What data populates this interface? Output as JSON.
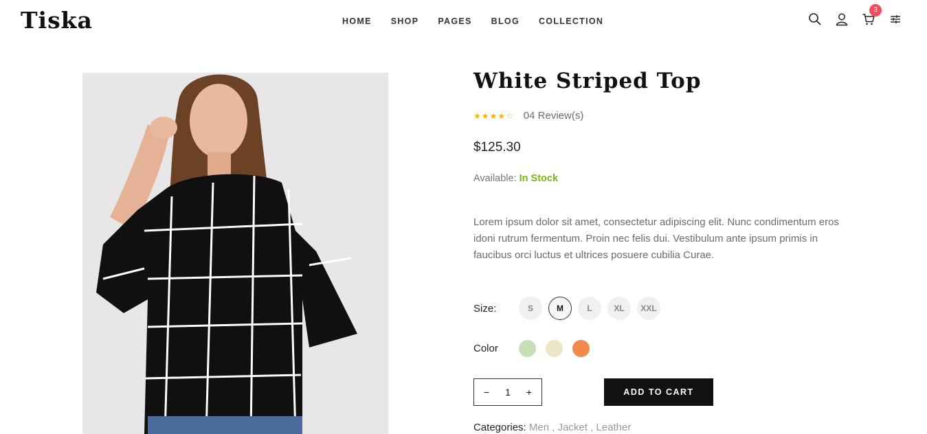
{
  "header": {
    "logo": "Tiska",
    "nav": [
      "HOME",
      "SHOP",
      "PAGES",
      "BLOG",
      "COLLECTION"
    ],
    "cart_count": "3",
    "icons": [
      "search-icon",
      "user-icon",
      "cart-icon",
      "filter-icon"
    ]
  },
  "product": {
    "title": "White Striped Top",
    "stars": "★★★★☆",
    "rating": 4.5,
    "reviews": "04 Review(s)",
    "price": "$125.30",
    "availability_label": "Available:",
    "availability_value": "In Stock",
    "description": "Lorem ipsum dolor sit amet, consectetur adipiscing elit. Nunc condimentum eros idoni rutrum fermentum. Proin nec felis dui. Vestibulum ante ipsum primis in faucibus orci luctus et ultrices posuere cubilia Curae.",
    "size_label": "Size:",
    "sizes": [
      "S",
      "M",
      "L",
      "XL",
      "XXL"
    ],
    "selected_size": "M",
    "color_label": "Color",
    "colors": [
      "#c5e0b8",
      "#ece5c8",
      "#ef8a4c"
    ],
    "quantity": "1",
    "qty_minus": "−",
    "qty_plus": "+",
    "add_to_cart": "ADD TO CART",
    "categories_label": "Categories:",
    "categories": [
      "Men ,",
      "Jacket",
      ", Leather"
    ]
  },
  "colors": {
    "accent_stock": "#7ab317",
    "badge": "#f24b5b",
    "stars": "#f5b400"
  }
}
